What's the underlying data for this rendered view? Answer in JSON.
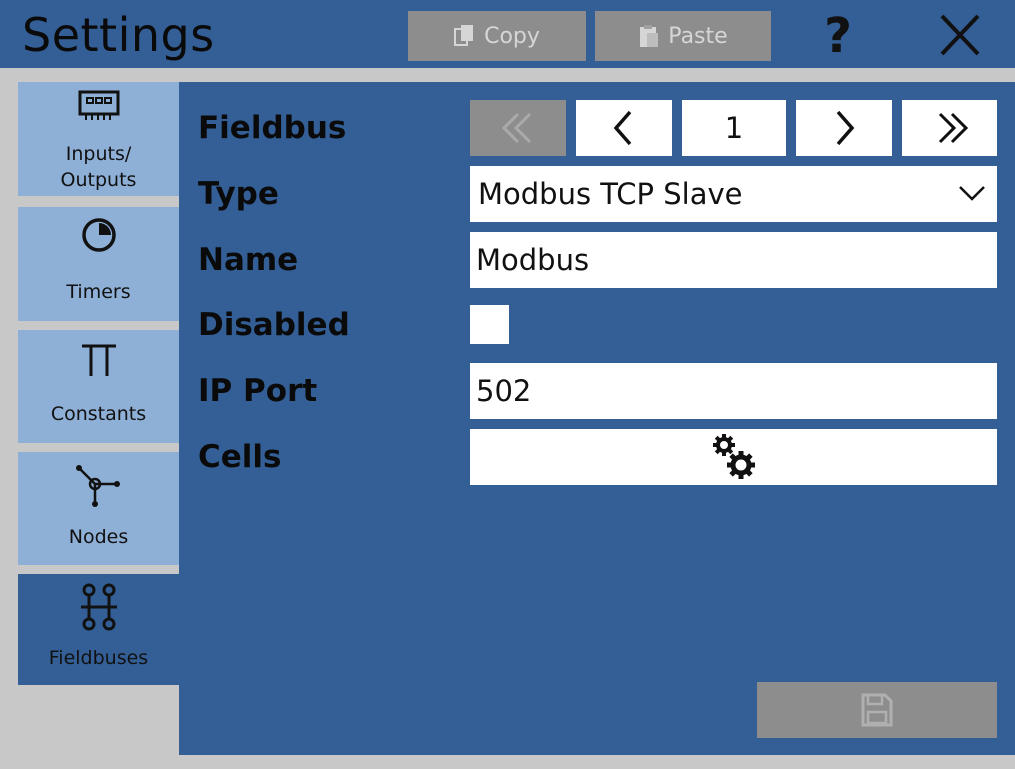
{
  "window": {
    "title": "Settings",
    "copy_label": "Copy",
    "paste_label": "Paste",
    "help_label": "?"
  },
  "sidebar": {
    "items": [
      {
        "label_line1": "Inputs/",
        "label_line2": "Outputs",
        "icon": "io-module-icon",
        "active": false
      },
      {
        "label": "Timers",
        "icon": "clock-icon",
        "active": false
      },
      {
        "label": "Constants",
        "icon": "pi-icon",
        "active": false
      },
      {
        "label": "Nodes",
        "icon": "node-icon",
        "active": false
      },
      {
        "label": "Fieldbuses",
        "icon": "fieldbus-icon",
        "active": true
      }
    ]
  },
  "form": {
    "fieldbus_label": "Fieldbus",
    "fieldbus_index": "1",
    "type_label": "Type",
    "type_value": "Modbus TCP Slave",
    "name_label": "Name",
    "name_value": "Modbus",
    "disabled_label": "Disabled",
    "disabled_checked": false,
    "ip_port_label": "IP Port",
    "ip_port_value": "502",
    "cells_label": "Cells"
  },
  "colors": {
    "primary": "#345f96",
    "sidebar_item": "#8eafd6",
    "disabled_button": "#8d8d8d",
    "background": "#c8c8c8"
  }
}
